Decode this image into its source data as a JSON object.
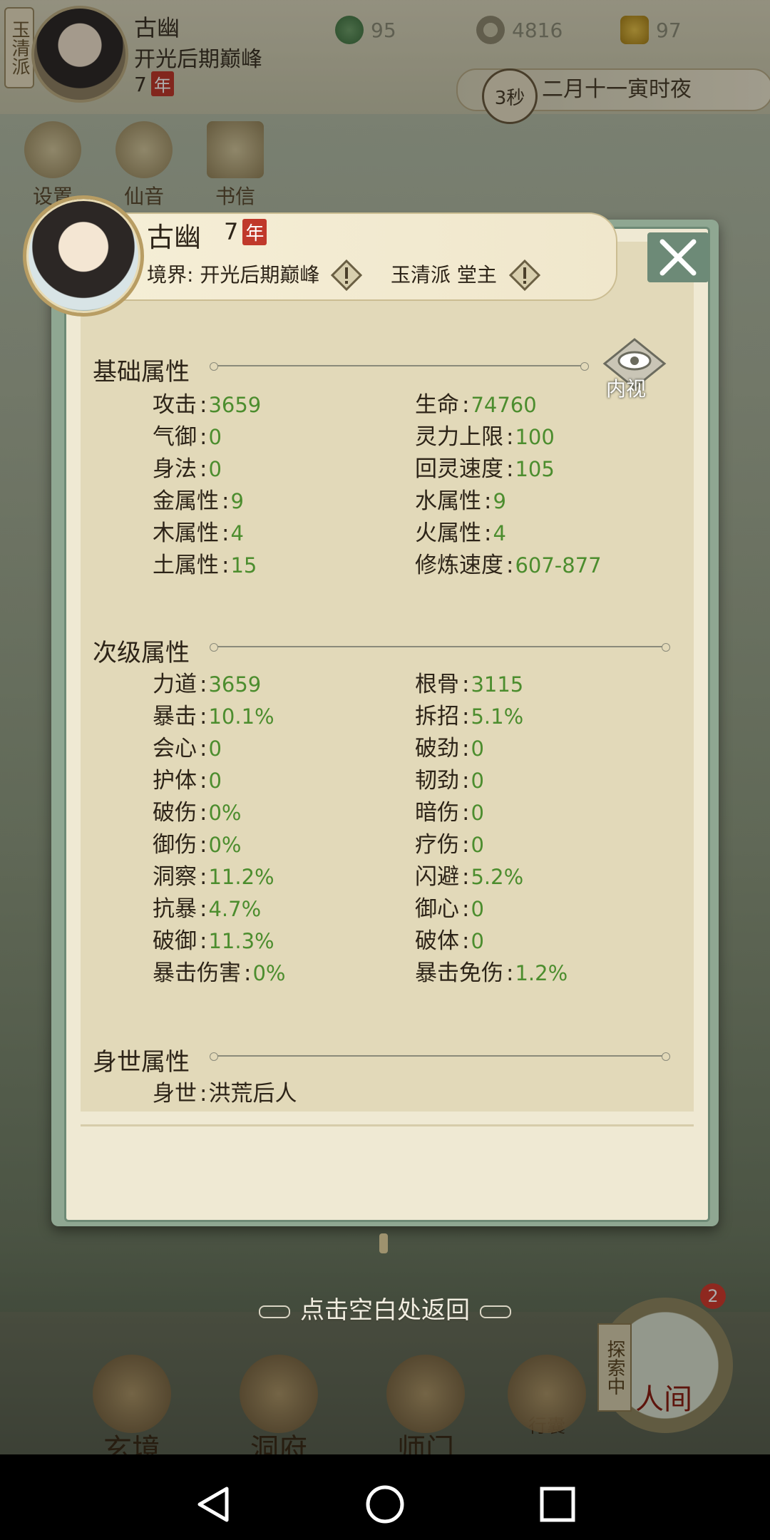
{
  "hud": {
    "sect_tag": "玉清派",
    "name": "古幽",
    "realm": "开光后期巅峰",
    "age": "7",
    "age_unit": "年",
    "resources": [
      {
        "icon": "jade-coin-icon",
        "value": "95"
      },
      {
        "icon": "copper-coin-icon",
        "value": "4816"
      },
      {
        "icon": "gold-ingot-icon",
        "value": "97"
      }
    ],
    "time_seconds": "3秒",
    "game_time": "二月十一寅时夜",
    "shortcuts": [
      "设置",
      "仙音",
      "书信"
    ]
  },
  "profile": {
    "name": "古幽",
    "age": "7",
    "age_unit": "年",
    "realm_label": "境界",
    "realm": "开光后期巅峰",
    "sect": "玉清派",
    "rank": "堂主"
  },
  "inner_view_label": "内视",
  "sections": {
    "basic": {
      "title": "基础属性",
      "left": [
        {
          "label": "攻击",
          "value": "3659"
        },
        {
          "label": "气御",
          "value": "0"
        },
        {
          "label": "身法",
          "value": "0"
        },
        {
          "label": "金属性",
          "value": "9"
        },
        {
          "label": "木属性",
          "value": "4"
        },
        {
          "label": "土属性",
          "value": "15"
        }
      ],
      "right": [
        {
          "label": "生命",
          "value": "74760"
        },
        {
          "label": "灵力上限",
          "value": "100"
        },
        {
          "label": "回灵速度",
          "value": "105"
        },
        {
          "label": "水属性",
          "value": "9"
        },
        {
          "label": "火属性",
          "value": "4"
        },
        {
          "label": "修炼速度",
          "value": "607-877"
        }
      ]
    },
    "secondary": {
      "title": "次级属性",
      "left": [
        {
          "label": "力道",
          "value": "3659"
        },
        {
          "label": "暴击",
          "value": "10.1%"
        },
        {
          "label": "会心",
          "value": "0"
        },
        {
          "label": "护体",
          "value": "0"
        },
        {
          "label": "破伤",
          "value": "0%"
        },
        {
          "label": "御伤",
          "value": "0%"
        },
        {
          "label": "洞察",
          "value": "11.2%"
        },
        {
          "label": "抗暴",
          "value": "4.7%"
        },
        {
          "label": "破御",
          "value": "11.3%"
        },
        {
          "label": "暴击伤害",
          "value": "0%"
        }
      ],
      "right": [
        {
          "label": "根骨",
          "value": "3115"
        },
        {
          "label": "拆招",
          "value": "5.1%"
        },
        {
          "label": "破劲",
          "value": "0"
        },
        {
          "label": "韧劲",
          "value": "0"
        },
        {
          "label": "暗伤",
          "value": "0"
        },
        {
          "label": "疗伤",
          "value": "0"
        },
        {
          "label": "闪避",
          "value": "5.2%"
        },
        {
          "label": "御心",
          "value": "0"
        },
        {
          "label": "破体",
          "value": "0"
        },
        {
          "label": "暴击免伤",
          "value": "1.2%"
        }
      ]
    },
    "origin": {
      "title": "身世属性",
      "left": [
        {
          "label": "身世",
          "value": "洪荒后人"
        }
      ]
    }
  },
  "return_hint": "点击空白处返回",
  "bottom_nav": [
    {
      "label": "玄境"
    },
    {
      "label": "洞府"
    },
    {
      "label": "师门"
    },
    {
      "label": "行囊"
    },
    {
      "label": "人间"
    }
  ],
  "explore": {
    "label": "探索中",
    "badge": "2"
  },
  "colors": {
    "value_green": "#4c8d2e",
    "panel_border": "#8fa792",
    "warn_red": "#c0392b"
  }
}
